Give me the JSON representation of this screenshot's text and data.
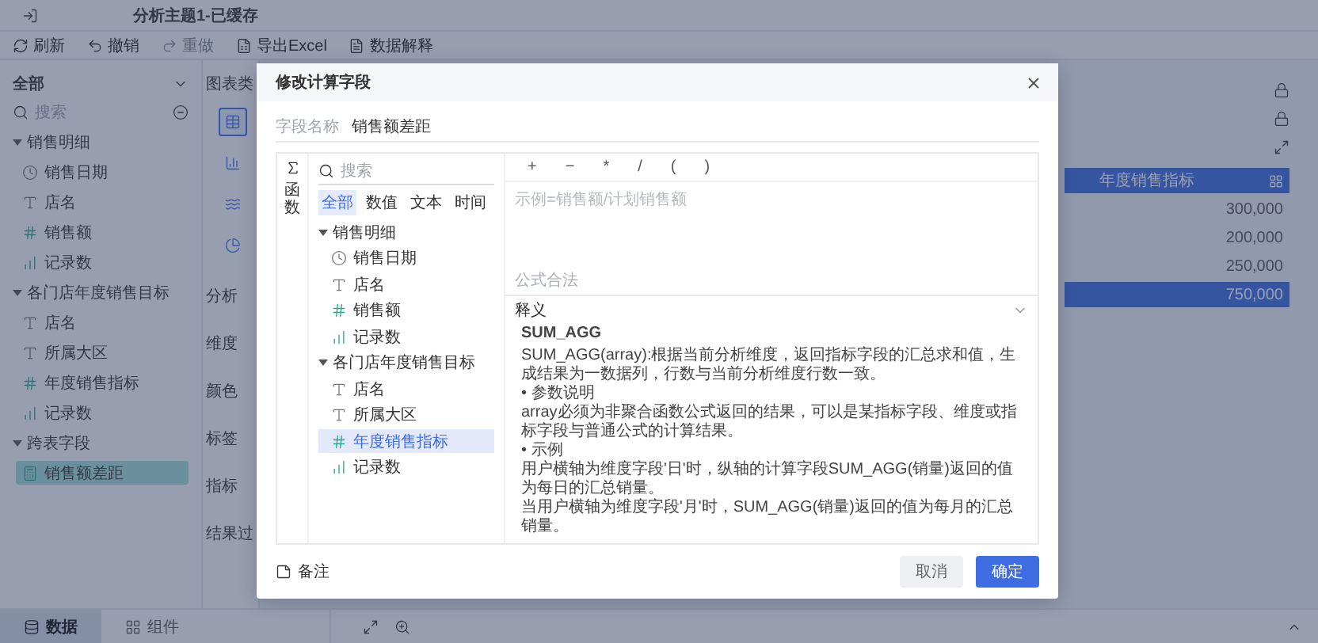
{
  "app": {
    "title": "分析主题1-已缓存",
    "toolbar": [
      {
        "label": "刷新",
        "kind": "refresh",
        "disabled": false
      },
      {
        "label": "撤销",
        "kind": "undo",
        "disabled": false
      },
      {
        "label": "重做",
        "kind": "redo",
        "disabled": true
      },
      {
        "label": "导出Excel",
        "kind": "export",
        "disabled": false
      },
      {
        "label": "数据解释",
        "kind": "explain",
        "disabled": false
      }
    ],
    "sidebar": {
      "scope": "全部",
      "search_placeholder": "搜索",
      "tree": [
        {
          "label": "销售明细",
          "expanded": true,
          "children": [
            {
              "label": "销售日期",
              "kind": "date",
              "selected": false
            },
            {
              "label": "店名",
              "kind": "text",
              "selected": false
            },
            {
              "label": "销售额",
              "kind": "number",
              "selected": false
            },
            {
              "label": "记录数",
              "kind": "count",
              "selected": false
            }
          ]
        },
        {
          "label": "各门店年度销售目标",
          "expanded": true,
          "children": [
            {
              "label": "店名",
              "kind": "text",
              "selected": false
            },
            {
              "label": "所属大区",
              "kind": "text",
              "selected": false
            },
            {
              "label": "年度销售指标",
              "kind": "number",
              "selected": false
            },
            {
              "label": "记录数",
              "kind": "count",
              "selected": false
            }
          ]
        },
        {
          "label": "跨表字段",
          "expanded": true,
          "children": [
            {
              "label": "销售额差距",
              "kind": "calc",
              "selected": true
            }
          ]
        }
      ]
    },
    "middle": {
      "heading": "图表类",
      "chart_types": [
        {
          "kind": "table",
          "selected": true
        },
        {
          "kind": "bar",
          "selected": false
        },
        {
          "kind": "wave",
          "selected": false
        },
        {
          "kind": "pie",
          "selected": false
        }
      ],
      "labels": [
        "分析",
        "维度",
        "颜色",
        "标签",
        "指标",
        "结果过"
      ]
    },
    "table": {
      "header": "年度销售指标",
      "rows": [
        {
          "value": "300,000",
          "total": false
        },
        {
          "value": "200,000",
          "total": false
        },
        {
          "value": "250,000",
          "total": false
        },
        {
          "value": "750,000",
          "total": true
        }
      ]
    },
    "bottom_tabs": [
      {
        "label": "数据",
        "kind": "data",
        "selected": true
      },
      {
        "label": "组件",
        "kind": "component",
        "selected": false
      }
    ]
  },
  "dialog": {
    "title": "修改计算字段",
    "field_label": "字段名称",
    "field_value": "销售额差距",
    "rail_label": "函数",
    "search_placeholder": "搜索",
    "type_tabs": [
      {
        "label": "全部",
        "selected": true
      },
      {
        "label": "数值",
        "selected": false
      },
      {
        "label": "文本",
        "selected": false
      },
      {
        "label": "时间",
        "selected": false
      }
    ],
    "tree": [
      {
        "label": "销售明细",
        "expanded": true,
        "children": [
          {
            "label": "销售日期",
            "kind": "date",
            "selected": false
          },
          {
            "label": "店名",
            "kind": "text",
            "selected": false
          },
          {
            "label": "销售额",
            "kind": "number",
            "selected": false
          },
          {
            "label": "记录数",
            "kind": "count",
            "selected": false
          }
        ]
      },
      {
        "label": "各门店年度销售目标",
        "expanded": true,
        "children": [
          {
            "label": "店名",
            "kind": "text",
            "selected": false
          },
          {
            "label": "所属大区",
            "kind": "text",
            "selected": false
          },
          {
            "label": "年度销售指标",
            "kind": "number",
            "selected": true
          },
          {
            "label": "记录数",
            "kind": "count",
            "selected": false
          }
        ]
      }
    ],
    "operators": [
      "+",
      "−",
      "*",
      "/",
      "(",
      ")"
    ],
    "formula_placeholder": "示例=销售额/计划销售额",
    "status": "公式合法",
    "explain": {
      "title": "释义",
      "expanded": true,
      "function_name": "SUM_AGG",
      "lines": [
        "SUM_AGG(array):根据当前分析维度，返回指标字段的汇总求和值，生成结果为一数据列，行数与当前分析维度行数一致。",
        "• 参数说明",
        "array必须为非聚合函数公式返回的结果，可以是某指标字段、维度或指标字段与普通公式的计算结果。",
        "• 示例",
        "用户横轴为维度字段'日'时，纵轴的计算字段SUM_AGG(销量)返回的值为每日的汇总销量。",
        "当用户横轴为维度字段'月'时，SUM_AGG(销量)返回的值为每月的汇总销量。"
      ]
    },
    "note": "备注",
    "buttons": [
      {
        "label": "取消",
        "kind": "secondary"
      },
      {
        "label": "确定",
        "kind": "primary"
      }
    ]
  }
}
